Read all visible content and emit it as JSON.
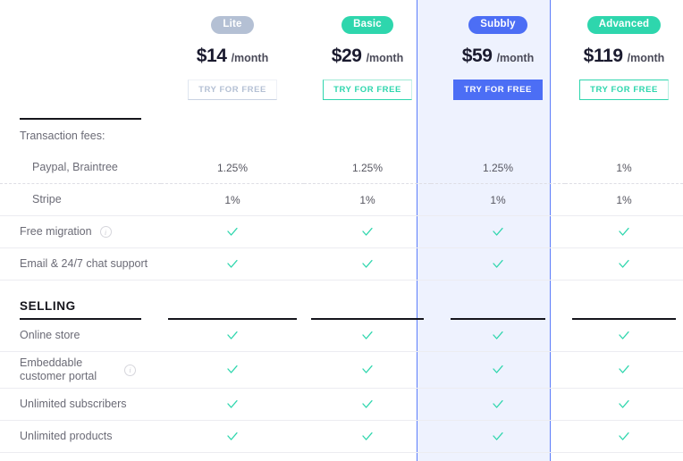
{
  "plans": [
    {
      "name": "Lite",
      "badge_style": "lite",
      "currency": "$",
      "amount": "14",
      "period": "/month",
      "cta_label": "TRY FOR FREE",
      "cta_style": "ghost-gray",
      "highlighted": false,
      "badge_color": "#b4c0d4"
    },
    {
      "name": "Basic",
      "badge_style": "basic",
      "currency": "$",
      "amount": "29",
      "period": "/month",
      "cta_label": "TRY FOR FREE",
      "cta_style": "ghost-teal",
      "highlighted": false,
      "badge_color": "#2ed6ad"
    },
    {
      "name": "Subbly",
      "badge_style": "subbly",
      "currency": "$",
      "amount": "59",
      "period": "/month",
      "cta_label": "TRY FOR FREE",
      "cta_style": "solid-blue",
      "highlighted": true,
      "badge_color": "#4c6ef5"
    },
    {
      "name": "Advanced",
      "badge_style": "advanced",
      "currency": "$",
      "amount": "119",
      "period": "/month",
      "cta_label": "TRY FOR FREE",
      "cta_style": "ghost-teal-2",
      "highlighted": false,
      "badge_color": "#2ed6ad"
    }
  ],
  "rows": [
    {
      "label": "Transaction fees:",
      "indent": false,
      "info": false,
      "values": [
        "",
        "",
        "",
        ""
      ],
      "type": "header"
    },
    {
      "label": "Paypal, Braintree",
      "indent": true,
      "info": false,
      "values": [
        "1.25%",
        "1.25%",
        "1.25%",
        "1%"
      ],
      "type": "text"
    },
    {
      "label": "Stripe",
      "indent": true,
      "info": false,
      "values": [
        "1%",
        "1%",
        "1%",
        "1%"
      ],
      "type": "text"
    },
    {
      "label": "Free migration",
      "indent": false,
      "info": true,
      "values": [
        "check",
        "check",
        "check",
        "check"
      ],
      "type": "check"
    },
    {
      "label": "Email & 24/7 chat support",
      "indent": false,
      "info": false,
      "values": [
        "check",
        "check",
        "check",
        "check"
      ],
      "type": "check"
    }
  ],
  "section": {
    "title": "SELLING"
  },
  "selling_rows": [
    {
      "label": "Online store",
      "info": false,
      "values": [
        "check",
        "check",
        "check",
        "check"
      ]
    },
    {
      "label": "Embeddable customer portal",
      "info": true,
      "values": [
        "check",
        "check",
        "check",
        "check"
      ]
    },
    {
      "label": "Unlimited subscribers",
      "info": false,
      "values": [
        "check",
        "check",
        "check",
        "check"
      ]
    },
    {
      "label": "Unlimited products",
      "info": false,
      "values": [
        "check",
        "check",
        "check",
        "check"
      ]
    }
  ],
  "icons": {
    "info": "i",
    "check": "check-icon"
  },
  "colors": {
    "check": "#2ed6ad",
    "highlight_bg": "#eef2fe",
    "highlight_border": "#5b7cfa",
    "accent_blue": "#4c6ef5",
    "accent_teal": "#2ed6ad"
  }
}
